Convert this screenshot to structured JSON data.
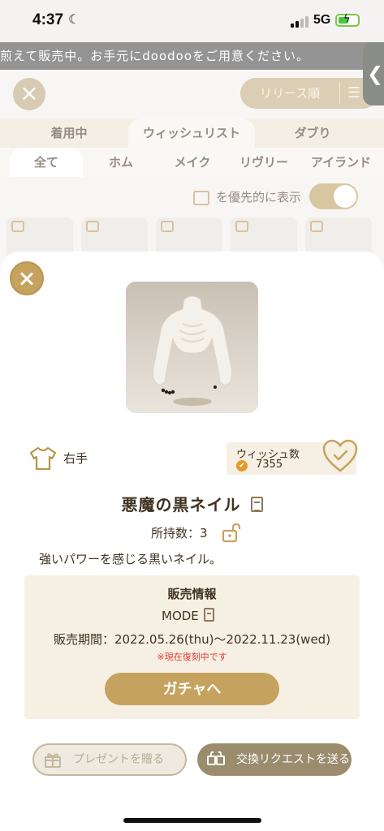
{
  "status_bar": {
    "time": "4:37",
    "network": "5G"
  },
  "ticker": "煎えて販売中。お手元にdoodooをご用意ください。",
  "background": {
    "sort_label": "リリース順",
    "tabs_primary": [
      "着用中",
      "ウィッシュリスト",
      "ダブり"
    ],
    "tabs_secondary": [
      "全て",
      "ホム",
      "メイク",
      "リヴリー",
      "アイランド"
    ],
    "priority_label": "を優先的に表示"
  },
  "item": {
    "part_label": "右手",
    "wish_title": "ウィッシュ数",
    "wish_count": "7355",
    "name": "悪魔の黒ネイル",
    "owned": "所持数：3",
    "description": "強いパワーを感じる黒いネイル。"
  },
  "sale": {
    "title": "販売情報",
    "mode": "MODE",
    "period": "販売期間：2022.05.26(thu)〜2022.11.23(wed)",
    "revival_note": "※現在復刻中です",
    "gacha_button": "ガチャへ"
  },
  "actions": {
    "present": "プレゼントを贈る",
    "trade": "交換リクエストを送る"
  },
  "colors": {
    "accent": "#c5a35e",
    "panel": "#f6efe3",
    "alert": "#e03a2e"
  }
}
